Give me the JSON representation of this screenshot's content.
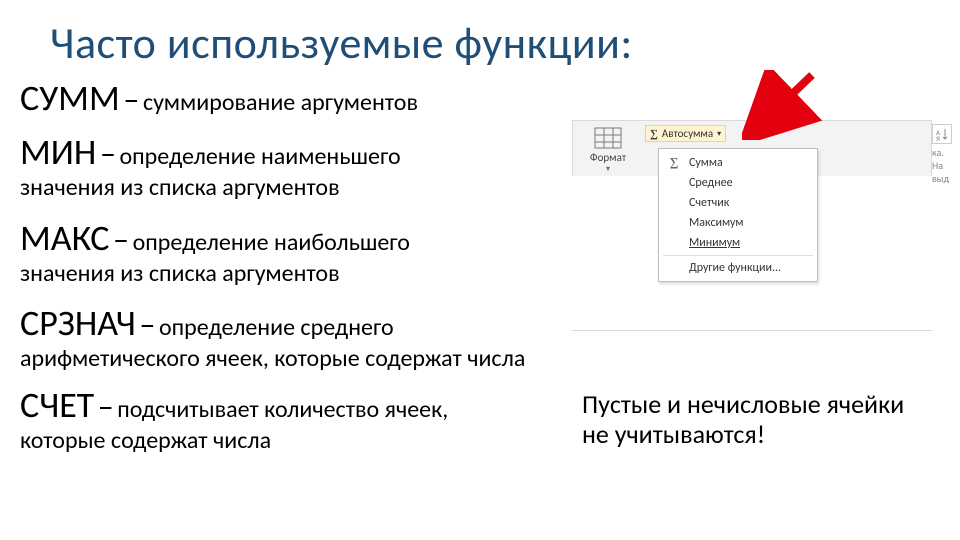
{
  "title": "Часто используемые функции:",
  "functions": {
    "sum": {
      "name": "СУММ",
      "dash": "–",
      "desc": "суммирование аргументов",
      "cont": ""
    },
    "min": {
      "name": "МИН",
      "dash": "–",
      "desc": "определение наименьшего",
      "cont": "значения из списка аргументов"
    },
    "max": {
      "name": "МАКС",
      "dash": "–",
      "desc": "определение наибольшего",
      "cont": "значения из списка аргументов"
    },
    "avg": {
      "name": "СРЗНАЧ",
      "dash": "–",
      "desc": "определение среднего",
      "cont": "арифметического ячеек, которые содержат числа"
    },
    "count": {
      "name": "СЧЕТ",
      "dash": "–",
      "desc": "подсчитывает количество ячеек,",
      "cont": "которые содержат числа"
    }
  },
  "ribbon": {
    "format_label": "Формат",
    "autosum_label": "Автосумма",
    "sigma": "∑",
    "behind_label1": "ка.",
    "behind_label2": "На",
    "behind_label3": "выд"
  },
  "menu": {
    "sum": "Сумма",
    "avg": "Среднее",
    "count": "Счетчик",
    "max": "Максимум",
    "min": "Минимум",
    "other": "Другие функции..."
  },
  "note": "Пустые и нечисловые ячейки не учитываются!"
}
